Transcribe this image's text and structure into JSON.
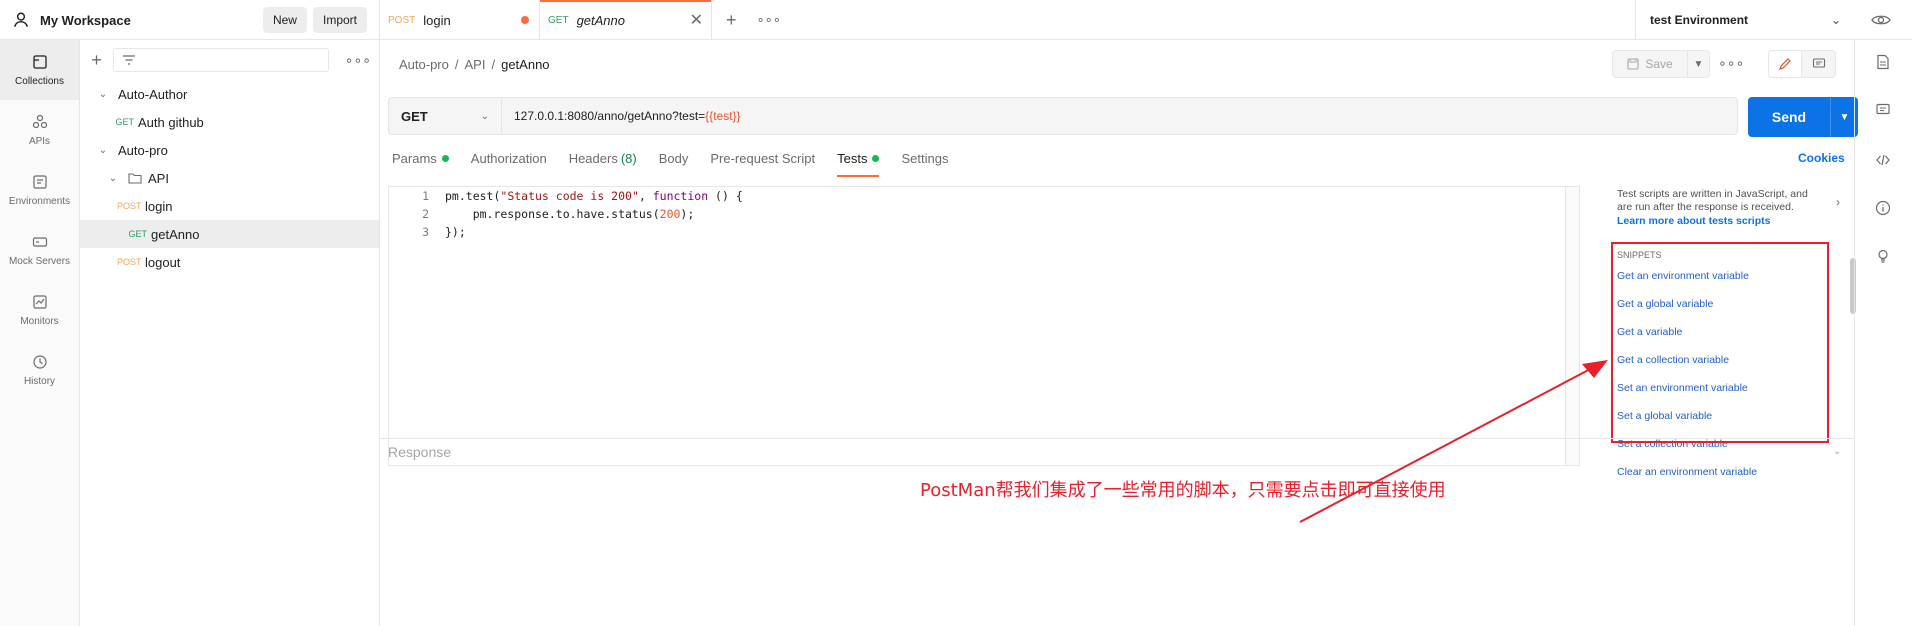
{
  "workspace": {
    "title": "My Workspace",
    "new_label": "New",
    "import_label": "Import"
  },
  "tabs": [
    {
      "method": "POST",
      "name": "login",
      "unsaved": true,
      "active": false
    },
    {
      "method": "GET",
      "name": "getAnno",
      "active": true
    }
  ],
  "environment": {
    "selected": "test Environment"
  },
  "rail": [
    {
      "label": "Collections",
      "icon": "collections-icon",
      "active": true
    },
    {
      "label": "APIs",
      "icon": "apis-icon"
    },
    {
      "label": "Environments",
      "icon": "environments-icon"
    },
    {
      "label": "Mock Servers",
      "icon": "mock-servers-icon"
    },
    {
      "label": "Monitors",
      "icon": "monitors-icon"
    },
    {
      "label": "History",
      "icon": "history-icon"
    }
  ],
  "tree": {
    "c1": {
      "name": "Auto-Author",
      "req": {
        "method": "GET",
        "name": "Auth github"
      }
    },
    "c2": {
      "name": "Auto-pro",
      "folder": "API",
      "r1": {
        "method": "POST",
        "name": "login"
      },
      "r2": {
        "method": "GET",
        "name": "getAnno"
      },
      "r3": {
        "method": "POST",
        "name": "logout"
      }
    }
  },
  "breadcrumb": {
    "b1": "Auto-pro",
    "sep": "/",
    "b2": "API",
    "b3": "getAnno"
  },
  "save_label": "Save",
  "request": {
    "method": "GET",
    "url_base": "127.0.0.1:8080/anno/getAnno?test=",
    "url_var": "{{test}}",
    "send_label": "Send"
  },
  "req_tabs": {
    "params": "Params",
    "auth": "Authorization",
    "headers": "Headers",
    "headers_count": "(8)",
    "body": "Body",
    "prereq": "Pre-request Script",
    "tests": "Tests",
    "settings": "Settings"
  },
  "cookies_label": "Cookies",
  "editor": {
    "ln1": "1",
    "ln2": "2",
    "ln3": "3"
  },
  "help": {
    "text": "Test scripts are written in JavaScript, and are run after the response is received.",
    "link": "Learn more about tests scripts"
  },
  "snippets": {
    "header": "SNIPPETS",
    "items": [
      "Get an environment variable",
      "Get a global variable",
      "Get a variable",
      "Get a collection variable",
      "Set an environment variable",
      "Set a global variable",
      "Set a collection variable",
      "Clear an environment variable"
    ]
  },
  "response_label": "Response",
  "annotation": "PostMan帮我们集成了一些常用的脚本，只需要点击即可直接使用",
  "colors": {
    "accent": "#ff6c37",
    "send": "#0c73e6",
    "annot": "#e8202a"
  }
}
